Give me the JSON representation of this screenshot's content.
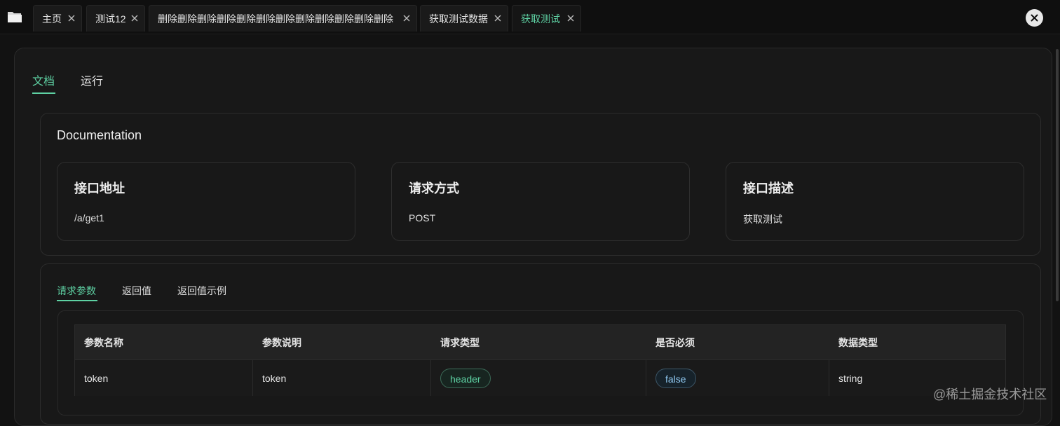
{
  "tabbar": {
    "folder_icon": "folder-icon",
    "tabs": [
      {
        "label": "主页",
        "active": false
      },
      {
        "label": "测试12",
        "active": false
      },
      {
        "label": "删除删除删除删除删除删除删除删除删除删除删除删除",
        "active": false
      },
      {
        "label": "获取测试数据",
        "active": false
      },
      {
        "label": "获取测试",
        "active": true
      }
    ],
    "close_icon": "close-icon"
  },
  "page_tabs": [
    {
      "label": "文档",
      "active": true
    },
    {
      "label": "运行",
      "active": false
    }
  ],
  "documentation": {
    "title": "Documentation",
    "cards": [
      {
        "title": "接口地址",
        "value": "/a/get1"
      },
      {
        "title": "请求方式",
        "value": "POST"
      },
      {
        "title": "接口描述",
        "value": "获取测试"
      }
    ]
  },
  "params": {
    "tabs": [
      {
        "label": "请求参数",
        "active": true
      },
      {
        "label": "返回值",
        "active": false
      },
      {
        "label": "返回值示例",
        "active": false
      }
    ],
    "table": {
      "columns": [
        "参数名称",
        "参数说明",
        "请求类型",
        "是否必须",
        "数据类型"
      ],
      "rows": [
        {
          "name": "token",
          "desc": "token",
          "in": "header",
          "required": "false",
          "type": "string"
        }
      ]
    }
  },
  "watermark": "@稀土掘金技术社区",
  "colors": {
    "accent": "#5ed1a3",
    "info": "#8fc7ef",
    "background": "#121212"
  }
}
